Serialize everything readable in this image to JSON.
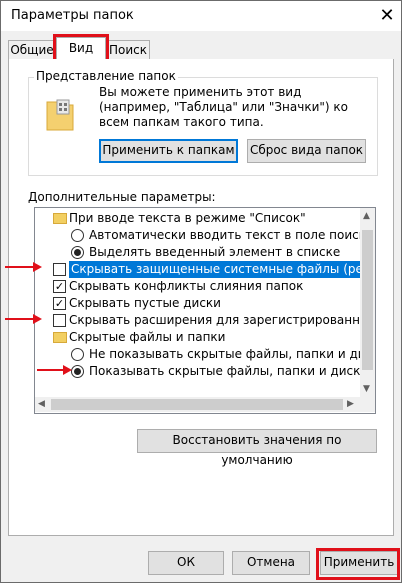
{
  "window": {
    "title": "Параметры папок"
  },
  "tabs": [
    {
      "label": "Общие"
    },
    {
      "label": "Вид"
    },
    {
      "label": "Поиск"
    }
  ],
  "folder_view": {
    "legend": "Представление папок",
    "description": "Вы можете применить этот вид (например, \"Таблица\" или \"Значки\") ко всем папкам такого типа.",
    "apply_button": "Применить к папкам",
    "reset_button": "Сброс вида папок"
  },
  "advanced": {
    "label": "Дополнительные параметры:",
    "items": [
      {
        "type": "folder",
        "text": "При вводе текста в режиме \"Список\""
      },
      {
        "type": "radio",
        "checked": false,
        "text": "Автоматически вводить текст в поле поиска"
      },
      {
        "type": "radio",
        "checked": true,
        "text": "Выделять введенный элемент в списке"
      },
      {
        "type": "checkbox",
        "checked": false,
        "selected": true,
        "text": "Скрывать защищенные системные файлы (рекомен"
      },
      {
        "type": "checkbox",
        "checked": true,
        "text": "Скрывать конфликты слияния папок"
      },
      {
        "type": "checkbox",
        "checked": true,
        "text": "Скрывать пустые диски"
      },
      {
        "type": "checkbox",
        "checked": false,
        "text": "Скрывать расширения для зарегистрированных типо"
      },
      {
        "type": "folder",
        "text": "Скрытые файлы и папки"
      },
      {
        "type": "radio",
        "checked": false,
        "text": "Не показывать скрытые файлы, папки и диски"
      },
      {
        "type": "radio",
        "checked": true,
        "text": "Показывать скрытые файлы, папки и диски"
      }
    ],
    "restore_button": "Восстановить значения по умолчанию"
  },
  "footer": {
    "ok": "ОК",
    "cancel": "Отмена",
    "apply": "Применить"
  },
  "colors": {
    "highlight_red": "#e0101a",
    "selection_blue": "#0078d7"
  }
}
